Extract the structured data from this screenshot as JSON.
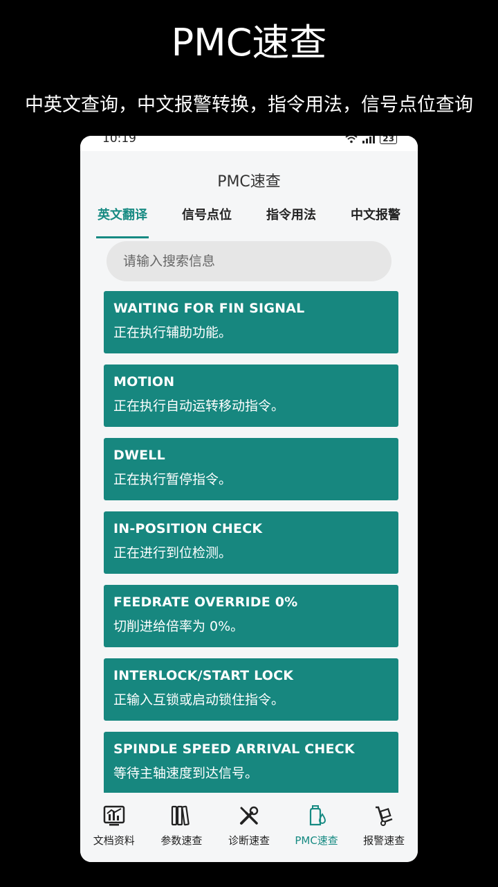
{
  "promo": {
    "title": "PMC速查",
    "subtitle": "中英文查询，中文报警转换，指令用法，信号点位查询"
  },
  "statusbar": {
    "time": "10:19",
    "battery": "23"
  },
  "app": {
    "title": "PMC速查"
  },
  "tabs": [
    {
      "label": "英文翻译",
      "active": true
    },
    {
      "label": "信号点位",
      "active": false
    },
    {
      "label": "指令用法",
      "active": false
    },
    {
      "label": "中文报警",
      "active": false
    }
  ],
  "search": {
    "placeholder": "请输入搜索信息"
  },
  "cards": [
    {
      "en": "WAITING FOR FIN SIGNAL",
      "zh": "正在执行辅助功能。"
    },
    {
      "en": "MOTION",
      "zh": "正在执行自动运转移动指令。"
    },
    {
      "en": "DWELL",
      "zh": "正在执行暂停指令。"
    },
    {
      "en": "IN-POSITION CHECK",
      "zh": "正在进行到位检测。"
    },
    {
      "en": "FEEDRATE OVERRIDE 0%",
      "zh": "切削进给倍率为 0%。"
    },
    {
      "en": "INTERLOCK/START LOCK",
      "zh": "正输入互锁或启动锁住指令。"
    },
    {
      "en": "SPINDLE SPEED ARRIVAL CHECK",
      "zh": "等待主轴速度到达信号。"
    }
  ],
  "nav": [
    {
      "label": "文档资料",
      "icon": "chart-monitor-icon",
      "active": false
    },
    {
      "label": "参数速查",
      "icon": "binders-icon",
      "active": false
    },
    {
      "label": "诊断速查",
      "icon": "tools-icon",
      "active": false
    },
    {
      "label": "PMC速查",
      "icon": "oil-bottle-icon",
      "active": true
    },
    {
      "label": "报警速查",
      "icon": "hand-truck-icon",
      "active": false
    }
  ],
  "colors": {
    "accent": "#168a82",
    "card": "#17877f",
    "background": "#f5f6f7"
  }
}
